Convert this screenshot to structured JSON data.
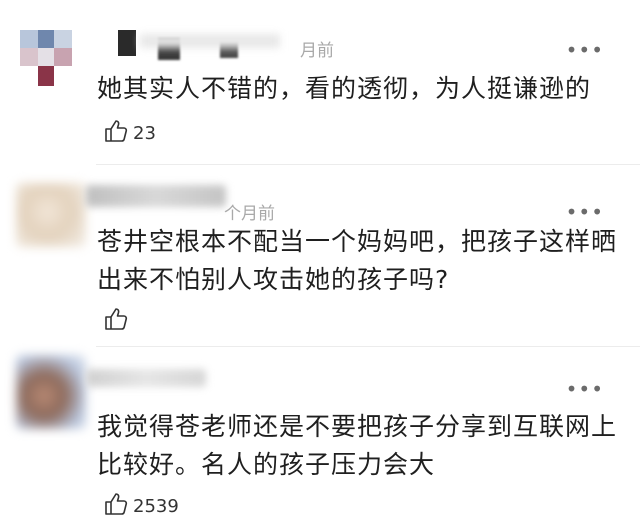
{
  "comments": [
    {
      "time": "月前",
      "text": "她其实人不错的，看的透彻，为人挺谦逊的",
      "likes": "23",
      "more_icon": "more-dots-icon",
      "like_icon": "thumbs-up-icon"
    },
    {
      "time": "个月前",
      "text": "苍井空根本不配当一个妈妈吧，把孩子这样晒出来不怕别人攻击她的孩子吗?",
      "likes": "",
      "more_icon": "more-dots-icon",
      "like_icon": "thumbs-up-icon"
    },
    {
      "time": "",
      "text": "我觉得苍老师还是不要把孩子分享到互联网上比较好。名人的孩子压力会大",
      "likes": "2539",
      "more_icon": "more-dots-icon",
      "like_icon": "thumbs-up-icon"
    }
  ]
}
